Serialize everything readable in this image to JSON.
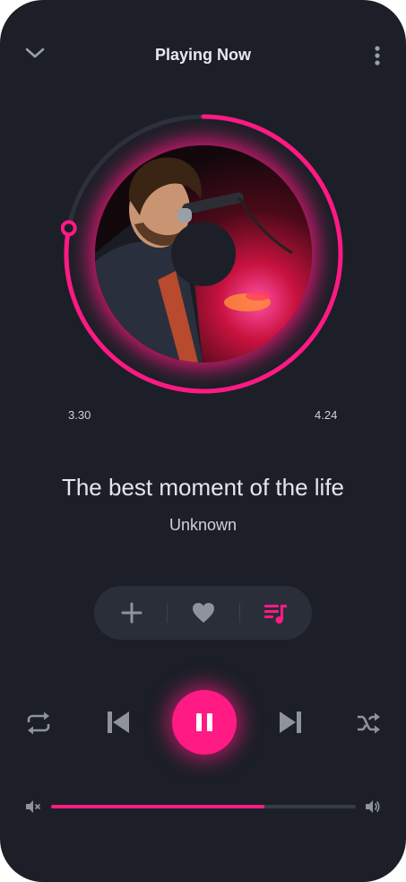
{
  "header": {
    "title": "Playing Now",
    "back_icon": "chevron-down-icon",
    "menu_icon": "more-vertical-icon"
  },
  "track": {
    "title": "The best moment of the life",
    "artist": "Unknown",
    "elapsed": "3.30",
    "duration": "4.24",
    "progress_fraction": 0.78
  },
  "actions": {
    "items": [
      {
        "icon": "plus-icon"
      },
      {
        "icon": "heart-icon"
      },
      {
        "icon": "playlist-icon"
      }
    ]
  },
  "controls": {
    "repeat_icon": "repeat-icon",
    "previous_icon": "skip-previous-icon",
    "play_state_icon": "pause-icon",
    "next_icon": "skip-next-icon",
    "shuffle_icon": "shuffle-icon"
  },
  "volume": {
    "level_fraction": 0.7,
    "min_icon": "volume-mute-icon",
    "max_icon": "volume-up-icon"
  },
  "colors": {
    "background": "#1c1f27",
    "accent": "#ff1a84",
    "panel": "#2a2e38",
    "icon_muted": "#8e939c",
    "text": "#e4e6ea"
  }
}
